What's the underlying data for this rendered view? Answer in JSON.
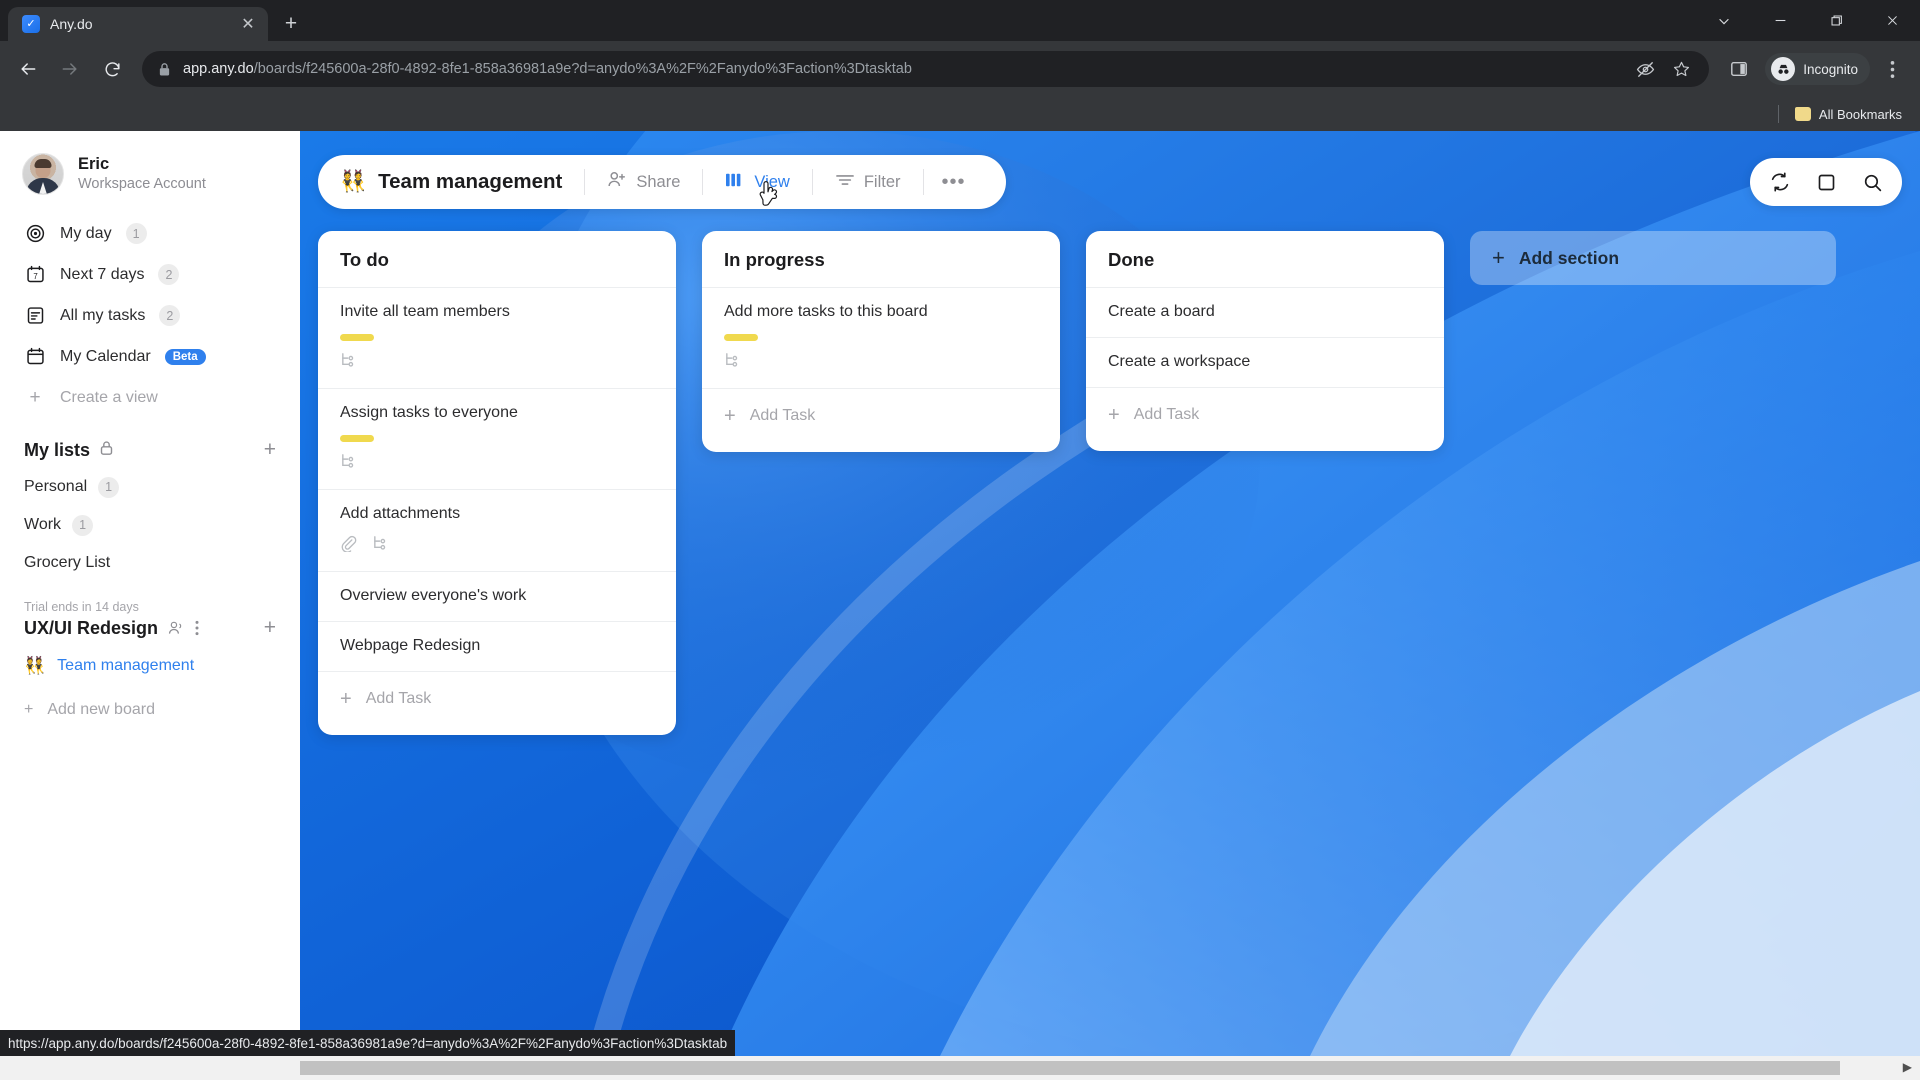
{
  "browser": {
    "tab": {
      "title": "Any.do",
      "favicon_icon": "anydo-check-icon",
      "close_icon": "close-icon"
    },
    "new_tab_label": "+",
    "window_controls": {
      "tab_search_icon": "chevron-down-icon",
      "minimize_icon": "minimize-icon",
      "restore_icon": "restore-icon",
      "close_icon": "close-icon"
    },
    "nav": {
      "back_icon": "arrow-left-icon",
      "forward_icon": "arrow-right-icon",
      "reload_icon": "reload-icon"
    },
    "omnibox": {
      "lock_icon": "lock-icon",
      "url_host": "app.any.do",
      "url_path": "/boards/f245600a-28f0-4892-8fe1-858a36981a9e?d=anydo%3A%2F%2Fanydo%3Faction%3Dtasktab",
      "tracking_icon": "eye-off-icon",
      "bookmark_icon": "star-icon"
    },
    "side_panel_icon": "side-panel-icon",
    "profile": {
      "label": "Incognito",
      "icon": "incognito-icon"
    },
    "menu_icon": "three-dots-vertical-icon",
    "bookmarks": {
      "folder_icon": "folder-icon",
      "label": "All Bookmarks"
    },
    "status_bar_url": "https://app.any.do/boards/f245600a-28f0-4892-8fe1-858a36981a9e?d=anydo%3A%2F%2Fanydo%3Faction%3Dtasktab"
  },
  "sidebar": {
    "profile": {
      "name": "Eric",
      "subtitle": "Workspace Account",
      "avatar_icon": "user-avatar"
    },
    "nav_items": [
      {
        "label": "My day",
        "icon": "target-icon",
        "count": "1"
      },
      {
        "label": "Next 7 days",
        "icon": "calendar-7-icon",
        "count": "2"
      },
      {
        "label": "All my tasks",
        "icon": "list-icon",
        "count": "2"
      },
      {
        "label": "My Calendar",
        "icon": "calendar-icon",
        "badge": "Beta"
      }
    ],
    "create_view": {
      "label": "Create a view",
      "icon": "plus-icon"
    },
    "my_lists": {
      "title": "My lists",
      "lock_icon": "lock-icon",
      "add_icon": "plus-icon",
      "items": [
        {
          "label": "Personal",
          "count": "1"
        },
        {
          "label": "Work",
          "count": "1"
        },
        {
          "label": "Grocery List",
          "count": ""
        }
      ]
    },
    "workspace": {
      "trial_notice": "Trial ends in 14 days",
      "name": "UX/UI Redesign",
      "members_icon": "people-icon",
      "more_icon": "three-dots-vertical-icon",
      "add_icon": "plus-icon",
      "boards": [
        {
          "emoji": "👯",
          "label": "Team management"
        }
      ],
      "add_board": {
        "label": "Add new board",
        "icon": "plus-icon"
      }
    }
  },
  "board": {
    "emoji": "👯",
    "title": "Team management",
    "toolbar": [
      {
        "label": "Share",
        "icon": "person-add-icon",
        "active": false
      },
      {
        "label": "View",
        "icon": "columns-icon",
        "active": true
      },
      {
        "label": "Filter",
        "icon": "filter-icon",
        "active": false
      }
    ],
    "more_label": "•••",
    "top_actions": [
      {
        "icon": "sync-icon",
        "name": "sync-button"
      },
      {
        "icon": "square-icon",
        "name": "focus-mode-button"
      },
      {
        "icon": "search-icon",
        "name": "search-button"
      }
    ],
    "accent_color": "#2f80ed",
    "tag_color": "#f0d94e",
    "background_color": "#0f6ede",
    "columns": [
      {
        "title": "To do",
        "cards": [
          {
            "text": "Invite all team members",
            "tag": true,
            "icons": [
              "subtask-icon"
            ]
          },
          {
            "text": "Assign tasks to everyone",
            "tag": true,
            "icons": [
              "subtask-icon"
            ]
          },
          {
            "text": "Add attachments",
            "tag": false,
            "icons": [
              "attachment-icon",
              "subtask-icon"
            ]
          },
          {
            "text": "Overview everyone's work",
            "tag": false,
            "icons": []
          },
          {
            "text": "Webpage Redesign",
            "tag": false,
            "icons": []
          }
        ],
        "add_task_label": "Add Task"
      },
      {
        "title": "In progress",
        "cards": [
          {
            "text": "Add more tasks to this board",
            "tag": true,
            "icons": [
              "subtask-icon"
            ]
          }
        ],
        "add_task_label": "Add Task"
      },
      {
        "title": "Done",
        "cards": [
          {
            "text": "Create a board",
            "tag": false,
            "icons": []
          },
          {
            "text": "Create a workspace",
            "tag": false,
            "icons": []
          }
        ],
        "add_task_label": "Add Task"
      }
    ],
    "add_section": {
      "label": "Add section",
      "icon": "plus-icon"
    }
  }
}
